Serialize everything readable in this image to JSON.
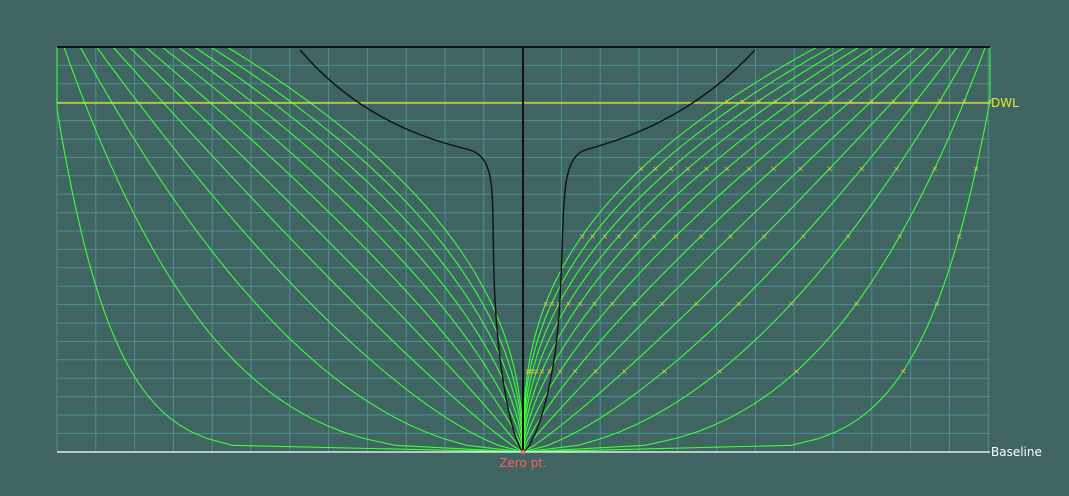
{
  "view": {
    "background": "#3f6461",
    "grid_color": "#4e8f93",
    "station_color": "#3cff3c",
    "frame_color": "#000000",
    "marker_color": "#d4c84a"
  },
  "labels": {
    "dwl": "DWL",
    "baseline": "Baseline",
    "zero_point": "Zero pt."
  },
  "label_colors": {
    "dwl": "#e8e830",
    "baseline": "#ffffff",
    "zero_point": "#ff6060"
  },
  "hull": {
    "stations_aft": 12,
    "stations_fwd": 14
  }
}
